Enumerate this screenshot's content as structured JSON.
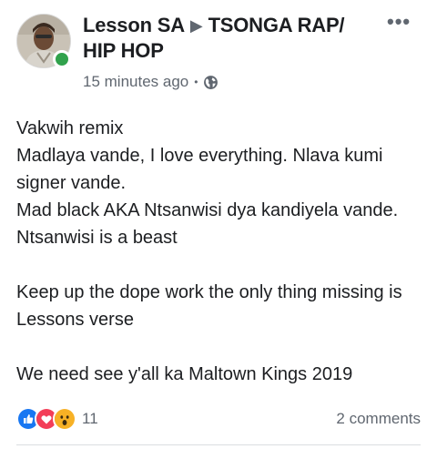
{
  "post": {
    "author": "Lesson SA",
    "group": "TSONGA RAP/ HIP HOP",
    "timestamp": "15 minutes ago",
    "privacy_icon": "globe-icon",
    "more_label": "•••",
    "body": "Vakwih remix\nMadlaya vande, I love everything. Nlava kumi signer vande.\nMad black AKA Ntsanwisi dya kandiyela vande. Ntsanwisi is a beast\n\nKeep up the dope work the only thing missing is Lessons verse\n\nWe need see y'all ka Maltown Kings 2019",
    "reactions": {
      "icons": [
        "like-icon",
        "love-icon",
        "wow-icon"
      ],
      "count": "11"
    },
    "comments_label": "2 comments"
  },
  "colors": {
    "online": "#31a24c",
    "like": "#1877f2",
    "love": "#f33e58",
    "wow": "#f7b125",
    "meta_text": "#606770"
  }
}
